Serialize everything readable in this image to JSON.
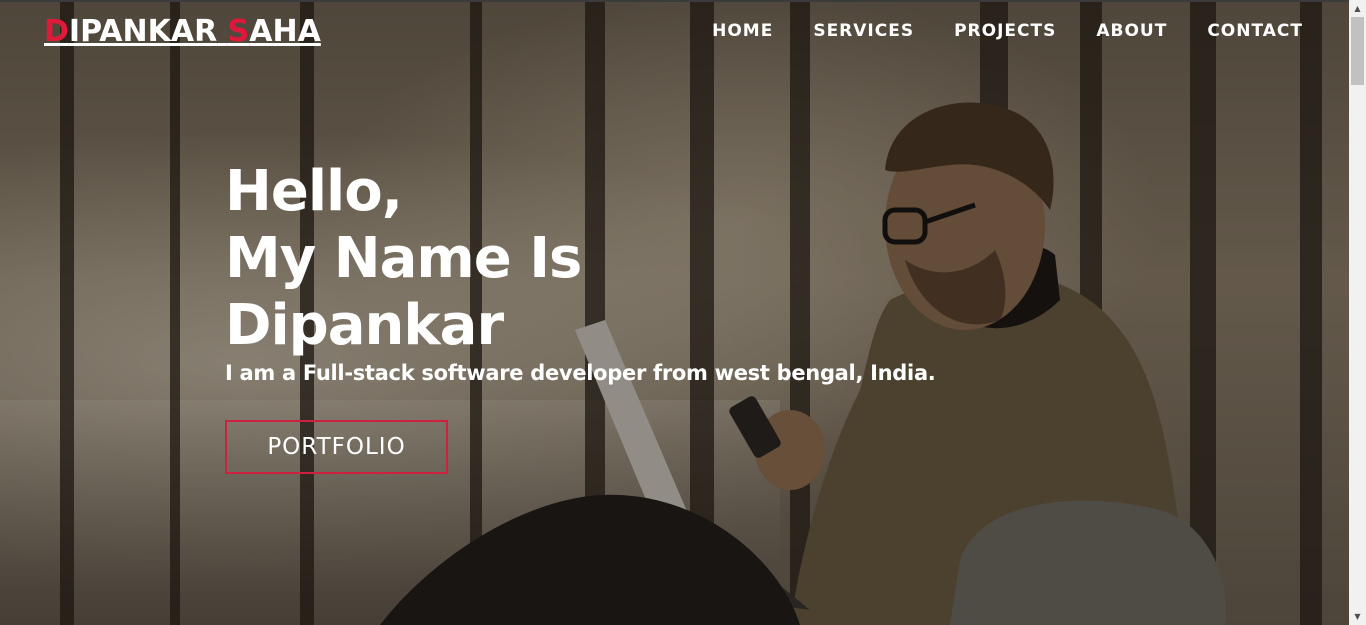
{
  "header": {
    "logo": {
      "first_initial": "D",
      "first_rest": "IPANKAR",
      "last_initial": "S",
      "last_rest": "AHA"
    },
    "nav": [
      {
        "label": "HOME"
      },
      {
        "label": "SERVICES"
      },
      {
        "label": "PROJECTS"
      },
      {
        "label": "ABOUT"
      },
      {
        "label": "CONTACT"
      }
    ]
  },
  "hero": {
    "title_lines": [
      "Hello,",
      "My Name Is",
      "Dipankar"
    ],
    "subtitle": "I am a Full-stack software developer from west bengal, India.",
    "button_label": "PORTFOLIO"
  },
  "colors": {
    "accent": "#e0193a",
    "button_border": "#d0203f",
    "text": "#ffffff"
  },
  "icons": {
    "scroll_up": "arrow-up-icon",
    "scroll_down": "arrow-down-icon"
  }
}
